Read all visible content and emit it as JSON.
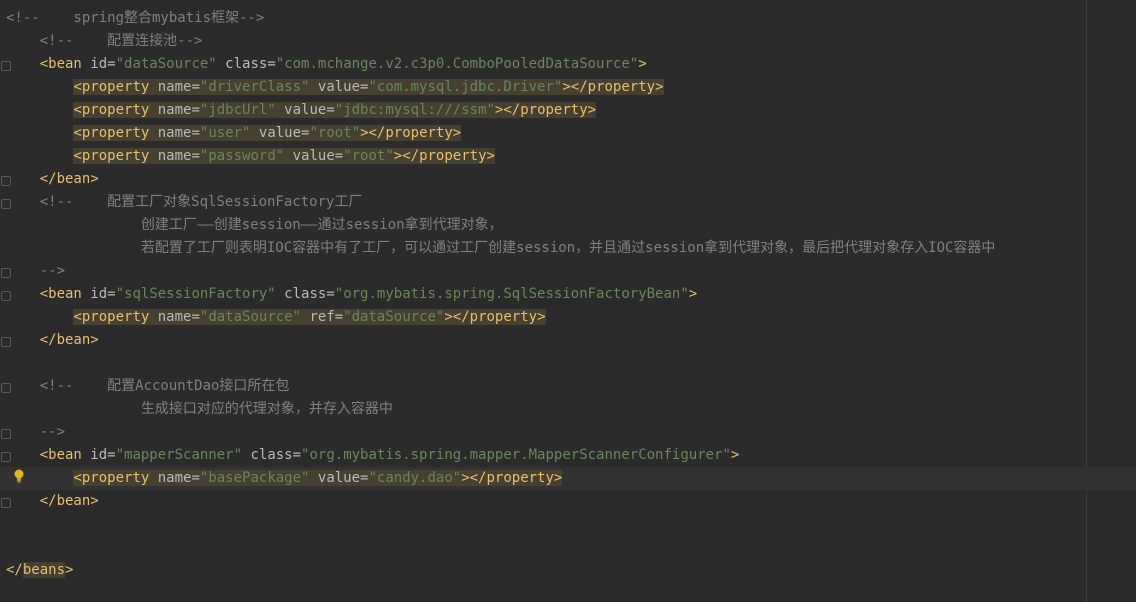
{
  "editor": {
    "language": "xml",
    "highlight_color": "#454030",
    "lines": [
      {
        "segments": [
          {
            "cls": "c",
            "text": "<!--    spring整合mybatis框架-->"
          }
        ]
      },
      {
        "segments": [
          {
            "cls": "c",
            "text": "    <!--    配置连接池-->"
          }
        ]
      },
      {
        "segments": [
          {
            "cls": "t",
            "text": "    <bean "
          },
          {
            "cls": "a",
            "text": "id="
          },
          {
            "cls": "v",
            "text": "\"dataSource\""
          },
          {
            "cls": "a",
            "text": " class="
          },
          {
            "cls": "v",
            "text": "\"com.mchange.v2.c3p0.ComboPooledDataSource\""
          },
          {
            "cls": "t",
            "text": ">"
          }
        ]
      },
      {
        "segments": [
          {
            "cls": "ws",
            "text": "        "
          },
          {
            "cls": "t hl",
            "text": "<property "
          },
          {
            "cls": "a hl",
            "text": "name="
          },
          {
            "cls": "v hl",
            "text": "\"driverClass\""
          },
          {
            "cls": "a hl",
            "text": " value="
          },
          {
            "cls": "v hl",
            "text": "\"com.mysql.jdbc.Driver\""
          },
          {
            "cls": "t hl",
            "text": "></property>"
          }
        ]
      },
      {
        "segments": [
          {
            "cls": "ws",
            "text": "        "
          },
          {
            "cls": "t hl",
            "text": "<property "
          },
          {
            "cls": "a hl",
            "text": "name="
          },
          {
            "cls": "v hl",
            "text": "\"jdbcUrl\""
          },
          {
            "cls": "a hl",
            "text": " value="
          },
          {
            "cls": "v hl",
            "text": "\"jdbc:mysql:///ssm\""
          },
          {
            "cls": "t hl",
            "text": "></property>"
          }
        ]
      },
      {
        "segments": [
          {
            "cls": "ws",
            "text": "        "
          },
          {
            "cls": "t hl",
            "text": "<property "
          },
          {
            "cls": "a hl",
            "text": "name="
          },
          {
            "cls": "v hl",
            "text": "\"user\""
          },
          {
            "cls": "a hl",
            "text": " value="
          },
          {
            "cls": "v hl",
            "text": "\"root\""
          },
          {
            "cls": "t hl",
            "text": "></property>"
          }
        ]
      },
      {
        "segments": [
          {
            "cls": "ws",
            "text": "        "
          },
          {
            "cls": "t hl",
            "text": "<property "
          },
          {
            "cls": "a hl",
            "text": "name="
          },
          {
            "cls": "v hl",
            "text": "\"password\""
          },
          {
            "cls": "a hl",
            "text": " value="
          },
          {
            "cls": "v hl",
            "text": "\"root\""
          },
          {
            "cls": "t hl",
            "text": "></property>"
          }
        ]
      },
      {
        "segments": [
          {
            "cls": "t",
            "text": "    </bean>"
          }
        ]
      },
      {
        "segments": [
          {
            "cls": "c",
            "text": "    <!--    配置工厂对象SqlSessionFactory工厂"
          }
        ]
      },
      {
        "segments": [
          {
            "cls": "c",
            "text": "                创建工厂——创建session——通过session拿到代理对象，"
          }
        ]
      },
      {
        "segments": [
          {
            "cls": "c",
            "text": "                若配置了工厂则表明IOC容器中有了工厂，可以通过工厂创建session，并且通过session拿到代理对象，最后把代理对象存入IOC容器中"
          }
        ]
      },
      {
        "segments": [
          {
            "cls": "c",
            "text": "    -->"
          }
        ]
      },
      {
        "segments": [
          {
            "cls": "t",
            "text": "    <bean "
          },
          {
            "cls": "a",
            "text": "id="
          },
          {
            "cls": "v",
            "text": "\"sqlSessionFactory\""
          },
          {
            "cls": "a",
            "text": " class="
          },
          {
            "cls": "v",
            "text": "\"org.mybatis.spring.SqlSessionFactoryBean\""
          },
          {
            "cls": "t",
            "text": ">"
          }
        ]
      },
      {
        "segments": [
          {
            "cls": "ws",
            "text": "        "
          },
          {
            "cls": "t hl",
            "text": "<property "
          },
          {
            "cls": "a hl",
            "text": "name="
          },
          {
            "cls": "v hl",
            "text": "\"dataSource\""
          },
          {
            "cls": "a hl",
            "text": " ref="
          },
          {
            "cls": "v hl",
            "text": "\"dataSource\""
          },
          {
            "cls": "t hl",
            "text": "></property>"
          }
        ]
      },
      {
        "segments": [
          {
            "cls": "t",
            "text": "    </bean>"
          }
        ]
      },
      {
        "segments": [
          {
            "cls": "ws",
            "text": " "
          }
        ]
      },
      {
        "segments": [
          {
            "cls": "c",
            "text": "    <!--    配置AccountDao接口所在包"
          }
        ]
      },
      {
        "segments": [
          {
            "cls": "c",
            "text": "                生成接口对应的代理对象，并存入容器中"
          }
        ]
      },
      {
        "segments": [
          {
            "cls": "c",
            "text": "    -->"
          }
        ]
      },
      {
        "segments": [
          {
            "cls": "t",
            "text": "    <bean "
          },
          {
            "cls": "a",
            "text": "id="
          },
          {
            "cls": "v",
            "text": "\"mapperScanner\""
          },
          {
            "cls": "a",
            "text": " class="
          },
          {
            "cls": "v",
            "text": "\"org.mybatis.spring.mapper.MapperScannerConfigurer\""
          },
          {
            "cls": "t",
            "text": ">"
          }
        ]
      },
      {
        "current": true,
        "segments": [
          {
            "cls": "ws",
            "text": "        "
          },
          {
            "cls": "t hl",
            "text": "<property "
          },
          {
            "cls": "a hl",
            "text": "name="
          },
          {
            "cls": "v hl",
            "text": "\"basePackage\""
          },
          {
            "cls": "a hl",
            "text": " value="
          },
          {
            "cls": "v hl",
            "text": "\"candy.dao\""
          },
          {
            "cls": "t hl",
            "text": "></property>"
          }
        ]
      },
      {
        "segments": [
          {
            "cls": "t",
            "text": "    </bean>"
          }
        ]
      },
      {
        "segments": [
          {
            "cls": "ws",
            "text": " "
          }
        ]
      },
      {
        "segments": [
          {
            "cls": "ws",
            "text": " "
          }
        ]
      },
      {
        "segments": [
          {
            "cls": "t",
            "text": "</"
          },
          {
            "cls": "t hl",
            "text": "beans"
          },
          {
            "cls": "t",
            "text": ">"
          }
        ]
      }
    ]
  },
  "gutter": {
    "intention_icon": "lightbulb-icon",
    "fold_markers": [
      2,
      7,
      8,
      11,
      12,
      14,
      16,
      18,
      19,
      21
    ]
  }
}
